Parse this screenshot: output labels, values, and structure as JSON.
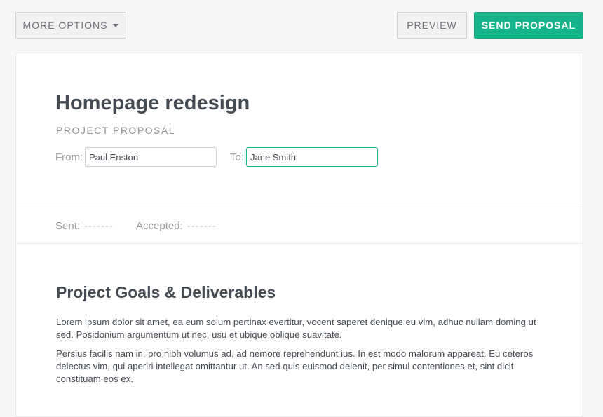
{
  "toolbar": {
    "more_options_label": "MORE OPTIONS",
    "preview_label": "PREVIEW",
    "send_label": "SEND PROPOSAL"
  },
  "proposal": {
    "title": "Homepage redesign",
    "subtitle": "PROJECT PROPOSAL",
    "from_label": "From:",
    "from_value": "Paul Enston",
    "to_label": "To:",
    "to_value": "Jane Smith"
  },
  "status": {
    "sent_label": "Sent:",
    "sent_value": "-------",
    "accepted_label": "Accepted:",
    "accepted_value": "-------"
  },
  "content": {
    "section_title": "Project Goals & Deliverables",
    "paragraphs": [
      "Lorem ipsum dolor sit amet, ea eum solum pertinax evertitur, vocent saperet denique eu vim, adhuc nullam doming ut sed. Posidonium argumentum ut nec, usu et ubique oblique suavitate.",
      "Persius facilis nam in, pro nibh volumus ad, ad nemore reprehendunt ius. In est modo malorum appareat. Eu ceteros delectus vim, qui aperiri intellegat omittantur ut. An sed quis euismod delenit, per simul contentiones et, sint dicit constituam eos ex."
    ]
  },
  "colors": {
    "accent": "#17b38a",
    "text": "#454b53",
    "muted": "#9a9ea3"
  },
  "icons": {
    "more_options_caret": "caret-down-icon"
  }
}
